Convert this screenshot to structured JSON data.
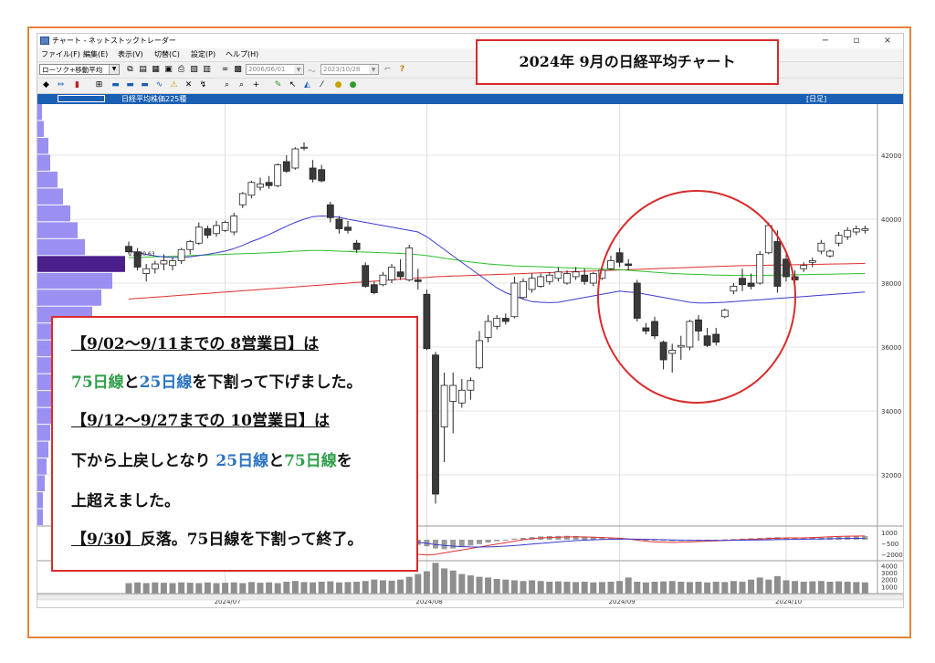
{
  "window": {
    "title": "チャート - ネットストックトレーダー",
    "controls": [
      "−",
      "▫",
      "×"
    ]
  },
  "menu": [
    "ファイル(F)",
    "編集(E)",
    "表示(V)",
    "切替(C)",
    "設定(P)",
    "ヘルプ(H)"
  ],
  "toolbar": {
    "chart_type": "ローソク+移動平均",
    "date_from": "2006/06/01",
    "date_sep": "〜",
    "date_to": "2023/10/28",
    "help": "?"
  },
  "chart_header": {
    "title": "日経平均株価225種",
    "period": "[日足]"
  },
  "callout_title": "2024年 9月の日経平均チャート",
  "notes": {
    "l1": "【9/02〜9/11までの 8営業日】は",
    "l2a": "75日線",
    "l2b": "と",
    "l2c": "25日線",
    "l2d": "を下割って下げました。",
    "l3": "【9/12〜9/27までの 10営業日】は",
    "l4a": "下から上戻しとなり ",
    "l4b": "25日線",
    "l4c": "と",
    "l4d": "75日線",
    "l4e": "を",
    "l5": "上超えました。",
    "l6a": "【9/30】",
    "l6b": "反落。75日線を下割って終了。"
  },
  "colors": {
    "accent_red": "#d92b2b",
    "ma25": "#3a3ad0",
    "ma75": "#29c229",
    "ma200": "#e03030",
    "header_blue": "#1a5fb4",
    "frame_orange": "#e8823a",
    "volume_profile": "#8a7cf0"
  },
  "chart_data": {
    "type": "candlestick",
    "price_ticks": [
      "42000",
      "40000",
      "38000",
      "36000",
      "34000",
      "32000"
    ],
    "macd_ticks": [
      "1000",
      "−500",
      "−2000"
    ],
    "volume_ticks": [
      "4000",
      "3000",
      "2000",
      "1000"
    ],
    "x_labels": [
      "2024/07",
      "2024/08",
      "2024/09",
      "2024/10"
    ],
    "ylim": [
      30400,
      43600
    ],
    "price_marker": "27530.63",
    "candles": [
      [
        39150,
        39300,
        38900,
        38980
      ],
      [
        38980,
        39100,
        38400,
        38500
      ],
      [
        38300,
        38600,
        38050,
        38450
      ],
      [
        38450,
        38700,
        38300,
        38600
      ],
      [
        38600,
        38900,
        38400,
        38700
      ],
      [
        38550,
        38800,
        38400,
        38700
      ],
      [
        38700,
        39100,
        38600,
        39050
      ],
      [
        39050,
        39350,
        38900,
        39300
      ],
      [
        39250,
        39900,
        39200,
        39750
      ],
      [
        39700,
        39800,
        39400,
        39500
      ],
      [
        39550,
        39950,
        39450,
        39800
      ],
      [
        39650,
        39950,
        39600,
        39900
      ],
      [
        39600,
        40200,
        39500,
        40100
      ],
      [
        40450,
        40850,
        40350,
        40800
      ],
      [
        40750,
        41200,
        40650,
        41150
      ],
      [
        41000,
        41300,
        40900,
        41100
      ],
      [
        41150,
        41350,
        40950,
        41050
      ],
      [
        41050,
        41750,
        41000,
        41700
      ],
      [
        41800,
        42000,
        41450,
        41500
      ],
      [
        41600,
        42250,
        41550,
        42200
      ],
      [
        42250,
        42400,
        42150,
        42250
      ],
      [
        41600,
        41850,
        41150,
        41250
      ],
      [
        41550,
        41700,
        41150,
        41200
      ],
      [
        40450,
        40550,
        39900,
        40050
      ],
      [
        40000,
        40100,
        39550,
        39700
      ],
      [
        39750,
        39950,
        39550,
        39650
      ],
      [
        39250,
        39350,
        38950,
        39050
      ],
      [
        38550,
        38650,
        37850,
        37900
      ],
      [
        37950,
        38050,
        37650,
        37700
      ],
      [
        37950,
        38350,
        37900,
        38250
      ],
      [
        38100,
        38600,
        38000,
        38500
      ],
      [
        38350,
        38750,
        38100,
        38200
      ],
      [
        38100,
        39200,
        38050,
        39100
      ],
      [
        38100,
        38450,
        37800,
        38050
      ],
      [
        37650,
        37800,
        35900,
        35950
      ],
      [
        35750,
        35850,
        31100,
        31400
      ],
      [
        33500,
        35200,
        32400,
        34800
      ],
      [
        34300,
        35200,
        33300,
        34800
      ],
      [
        34250,
        35000,
        34100,
        34650
      ],
      [
        34650,
        35050,
        34350,
        34950
      ],
      [
        35350,
        36500,
        35300,
        36200
      ],
      [
        36300,
        37000,
        36150,
        36800
      ],
      [
        36650,
        37000,
        36550,
        36900
      ],
      [
        36900,
        37050,
        36700,
        36800
      ],
      [
        36950,
        38200,
        36900,
        38000
      ],
      [
        37550,
        38150,
        37500,
        38050
      ],
      [
        37800,
        38300,
        37700,
        38150
      ],
      [
        37900,
        38300,
        37850,
        38200
      ],
      [
        38050,
        38350,
        37950,
        38250
      ],
      [
        38150,
        38500,
        38050,
        38350
      ],
      [
        38000,
        38400,
        37950,
        38300
      ],
      [
        38200,
        38500,
        38100,
        38350
      ],
      [
        38250,
        38450,
        37950,
        38050
      ],
      [
        38000,
        38350,
        37900,
        38300
      ],
      [
        38150,
        38500,
        38100,
        38400
      ],
      [
        38450,
        38850,
        38400,
        38700
      ],
      [
        38950,
        39100,
        38500,
        38650
      ],
      [
        38600,
        38750,
        38400,
        38550
      ],
      [
        38000,
        38100,
        36800,
        36900
      ],
      [
        36600,
        36750,
        36400,
        36500
      ],
      [
        36800,
        36950,
        36250,
        36350
      ],
      [
        36150,
        36200,
        35300,
        35600
      ],
      [
        35800,
        36100,
        35200,
        35900
      ],
      [
        36000,
        36350,
        35600,
        36050
      ],
      [
        36000,
        36850,
        35900,
        36800
      ],
      [
        36850,
        37000,
        36200,
        36500
      ],
      [
        36350,
        36600,
        36000,
        36050
      ],
      [
        36400,
        36600,
        36050,
        36150
      ],
      [
        36950,
        37200,
        36900,
        37150
      ],
      [
        37750,
        38000,
        37650,
        37900
      ],
      [
        38150,
        38450,
        37750,
        37950
      ],
      [
        38000,
        38300,
        37800,
        37900
      ],
      [
        38000,
        39000,
        37950,
        38900
      ],
      [
        38950,
        39900,
        38900,
        39800
      ],
      [
        39300,
        39650,
        37700,
        37900
      ],
      [
        38750,
        38900,
        38050,
        38200
      ],
      [
        38200,
        38400,
        38000,
        38100
      ],
      [
        38450,
        38650,
        38350,
        38550
      ],
      [
        38650,
        38800,
        38500,
        38700
      ],
      [
        39000,
        39350,
        38900,
        39250
      ],
      [
        38850,
        39050,
        38800,
        39000
      ],
      [
        39250,
        39600,
        39150,
        39500
      ],
      [
        39450,
        39750,
        39350,
        39650
      ],
      [
        39600,
        39800,
        39500,
        39700
      ],
      [
        39650,
        39800,
        39550,
        39700
      ]
    ],
    "ma25": [
      39000,
      38950,
      38900,
      38850,
      38820,
      38800,
      38800,
      38820,
      38860,
      38900,
      38950,
      39000,
      39080,
      39180,
      39300,
      39400,
      39520,
      39650,
      39780,
      39900,
      40000,
      40080,
      40100,
      40090,
      40060,
      40000,
      39950,
      39900,
      39850,
      39800,
      39750,
      39700,
      39650,
      39600,
      39450,
      39250,
      39050,
      38850,
      38650,
      38450,
      38250,
      38050,
      37850,
      37700,
      37600,
      37500,
      37420,
      37400,
      37390,
      37400,
      37450,
      37500,
      37550,
      37600,
      37650,
      37700,
      37750,
      37720,
      37700,
      37650,
      37600,
      37550,
      37500,
      37450,
      37400,
      37380,
      37380,
      37390,
      37400,
      37420,
      37440,
      37460,
      37480,
      37500,
      37520,
      37540,
      37560,
      37580,
      37600,
      37620,
      37640,
      37660,
      37680,
      37700,
      37720
    ],
    "ma75": [
      38800,
      38800,
      38810,
      38820,
      38830,
      38840,
      38850,
      38860,
      38870,
      38880,
      38890,
      38900,
      38910,
      38920,
      38930,
      38940,
      38950,
      38960,
      38980,
      39000,
      39010,
      39020,
      39020,
      39010,
      39000,
      38990,
      38980,
      38970,
      38960,
      38950,
      38940,
      38930,
      38910,
      38890,
      38860,
      38820,
      38780,
      38740,
      38700,
      38660,
      38630,
      38600,
      38580,
      38560,
      38540,
      38530,
      38520,
      38510,
      38500,
      38490,
      38480,
      38470,
      38460,
      38450,
      38440,
      38430,
      38420,
      38400,
      38380,
      38360,
      38340,
      38320,
      38300,
      38290,
      38280,
      38270,
      38260,
      38250,
      38245,
      38240,
      38240,
      38240,
      38240,
      38245,
      38250,
      38255,
      38260,
      38265,
      38270,
      38275,
      38280,
      38285,
      38290,
      38295,
      38300
    ],
    "ma200": [
      37500,
      37520,
      37540,
      37560,
      37580,
      37600,
      37620,
      37640,
      37660,
      37680,
      37700,
      37720,
      37740,
      37760,
      37780,
      37800,
      37820,
      37840,
      37860,
      37880,
      37900,
      37920,
      37940,
      37960,
      37980,
      38000,
      38020,
      38040,
      38060,
      38080,
      38100,
      38120,
      38140,
      38160,
      38180,
      38200,
      38210,
      38220,
      38230,
      38240,
      38250,
      38260,
      38270,
      38280,
      38290,
      38300,
      38310,
      38320,
      38330,
      38340,
      38350,
      38360,
      38370,
      38380,
      38390,
      38400,
      38410,
      38420,
      38430,
      38440,
      38450,
      38460,
      38470,
      38480,
      38490,
      38500,
      38510,
      38520,
      38530,
      38540,
      38545,
      38550,
      38555,
      38560,
      38565,
      38570,
      38575,
      38580,
      38585,
      38590,
      38595,
      38600,
      38605,
      38610,
      38615
    ],
    "volume": [
      1500,
      1600,
      1500,
      1600,
      1550,
      1500,
      1600,
      1550,
      1500,
      1600,
      1500,
      1550,
      1600,
      1500,
      1650,
      1550,
      1600,
      1500,
      1700,
      1800,
      1650,
      1600,
      1700,
      1750,
      1600,
      1650,
      1700,
      1800,
      2000,
      1900,
      1850,
      2000,
      2400,
      2800,
      3200,
      4400,
      3600,
      3300,
      2800,
      2600,
      2400,
      2300,
      2100,
      2000,
      1900,
      1800,
      1900,
      1800,
      1700,
      1750,
      1700,
      1650,
      1700,
      1600,
      1650,
      1700,
      1800,
      2300,
      1700,
      1600,
      1700,
      1750,
      1800,
      1700,
      1650,
      1700,
      1600,
      1700,
      1650,
      1800,
      1700,
      2000,
      2300,
      2000,
      2500,
      1900,
      1800,
      1700,
      1750,
      1800,
      1700,
      1750,
      1700,
      1650,
      1600
    ],
    "macd_hist": [
      200,
      180,
      150,
      120,
      100,
      80,
      70,
      80,
      100,
      150,
      200,
      250,
      300,
      350,
      400,
      420,
      450,
      480,
      500,
      520,
      500,
      450,
      400,
      300,
      200,
      100,
      0,
      -100,
      -200,
      -300,
      -400,
      -500,
      -600,
      -700,
      -900,
      -1200,
      -1300,
      -1200,
      -1000,
      -800,
      -600,
      -400,
      -200,
      0,
      150,
      250,
      350,
      450,
      500,
      520,
      530,
      500,
      450,
      400,
      350,
      300,
      250,
      150,
      50,
      -50,
      -100,
      -150,
      -200,
      -180,
      -150,
      -100,
      -50,
      0,
      50,
      100,
      150,
      200,
      250,
      300,
      350,
      300,
      250,
      200,
      250,
      300,
      350,
      400,
      420,
      450,
      480
    ],
    "macd_line": [
      500,
      480,
      450,
      420,
      400,
      380,
      370,
      380,
      400,
      450,
      500,
      550,
      600,
      650,
      700,
      720,
      750,
      780,
      800,
      820,
      800,
      750,
      700,
      600,
      450,
      300,
      100,
      -200,
      -500,
      -800,
      -1100,
      -1400,
      -1700,
      -2000,
      -2100,
      -2000,
      -1800,
      -1600,
      -1400,
      -1200,
      -1000,
      -800,
      -600,
      -400,
      -200,
      0,
      150,
      250,
      300,
      350,
      380,
      400,
      380,
      350,
      300,
      250,
      200,
      100,
      -50,
      -200,
      -300,
      -350,
      -380,
      -350,
      -300,
      -250,
      -200,
      -150,
      -100,
      -50,
      0,
      50,
      100,
      150,
      200,
      250,
      250,
      250,
      300,
      350,
      400,
      450,
      480,
      500,
      520
    ],
    "macd_signal": [
      400,
      400,
      400,
      400,
      390,
      380,
      375,
      375,
      380,
      390,
      410,
      430,
      460,
      490,
      520,
      550,
      580,
      610,
      640,
      670,
      690,
      700,
      700,
      690,
      660,
      620,
      560,
      480,
      380,
      260,
      130,
      -20,
      -180,
      -350,
      -500,
      -650,
      -780,
      -880,
      -950,
      -990,
      -1000,
      -980,
      -940,
      -880,
      -800,
      -700,
      -600,
      -500,
      -400,
      -300,
      -200,
      -120,
      -60,
      -10,
      30,
      60,
      80,
      90,
      80,
      60,
      30,
      0,
      -30,
      -60,
      -80,
      -90,
      -100,
      -100,
      -95,
      -85,
      -70,
      -50,
      -30,
      -10,
      10,
      30,
      50,
      70,
      90,
      110,
      130,
      150,
      170,
      190,
      210
    ],
    "volume_profile": [
      5,
      7,
      12,
      14,
      22,
      28,
      36,
      44,
      52,
      96,
      82,
      70,
      60,
      48,
      38,
      30,
      24,
      20,
      18,
      14,
      12,
      10,
      8,
      6,
      6
    ]
  }
}
